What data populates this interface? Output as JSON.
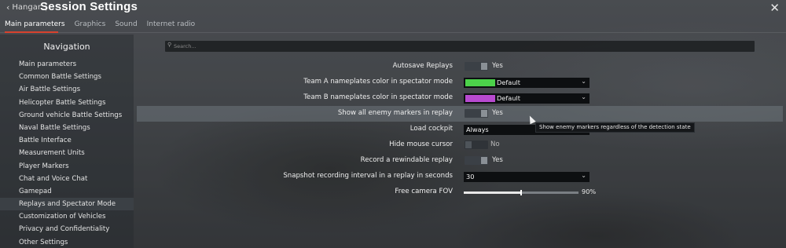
{
  "header": {
    "back_label": "Hangar",
    "separator": "|",
    "title": "Session Settings",
    "close_glyph": "✕"
  },
  "tabs": [
    {
      "label": "Main parameters",
      "active": true
    },
    {
      "label": "Graphics",
      "active": false
    },
    {
      "label": "Sound",
      "active": false
    },
    {
      "label": "Internet radio",
      "active": false
    }
  ],
  "accent_color": "#d8422e",
  "sidebar": {
    "title": "Navigation",
    "items": [
      {
        "label": "Main parameters",
        "active": false
      },
      {
        "label": "Common Battle Settings",
        "active": false
      },
      {
        "label": "Air Battle Settings",
        "active": false
      },
      {
        "label": "Helicopter Battle Settings",
        "active": false
      },
      {
        "label": "Ground vehicle Battle Settings",
        "active": false
      },
      {
        "label": "Naval Battle Settings",
        "active": false
      },
      {
        "label": "Battle Interface",
        "active": false
      },
      {
        "label": "Measurement Units",
        "active": false
      },
      {
        "label": "Player Markers",
        "active": false
      },
      {
        "label": "Chat and Voice Chat",
        "active": false
      },
      {
        "label": "Gamepad",
        "active": false
      },
      {
        "label": "Replays and Spectator Mode",
        "active": true
      },
      {
        "label": "Customization of Vehicles",
        "active": false
      },
      {
        "label": "Privacy and Confidentiality",
        "active": false
      },
      {
        "label": "Other Settings",
        "active": false
      }
    ]
  },
  "search": {
    "icon": "search-icon",
    "placeholder": "Search..."
  },
  "settings": {
    "autosave": {
      "label": "Autosave Replays",
      "value": "Yes",
      "on": true
    },
    "team_a": {
      "label": "Team A nameplates color in spectator mode",
      "value": "Default",
      "swatch": "#4cd14a"
    },
    "team_b": {
      "label": "Team B nameplates color in spectator mode",
      "value": "Default",
      "swatch": "#b84ad0"
    },
    "enemy_markers": {
      "label": "Show all enemy markers in replay",
      "value": "Yes",
      "on": true
    },
    "load_cockpit": {
      "label": "Load cockpit",
      "value": "Always"
    },
    "hide_cursor": {
      "label": "Hide mouse cursor",
      "value": "No",
      "on": false
    },
    "rewindable": {
      "label": "Record a rewindable replay",
      "value": "Yes",
      "on": true
    },
    "snapshot": {
      "label": "Snapshot recording interval in a replay in seconds",
      "value": "30"
    },
    "fov": {
      "label": "Free camera FOV",
      "value_text": "90%",
      "fraction": 0.5
    }
  },
  "tooltip": {
    "text": "Show enemy markers regardless of the detection state"
  }
}
